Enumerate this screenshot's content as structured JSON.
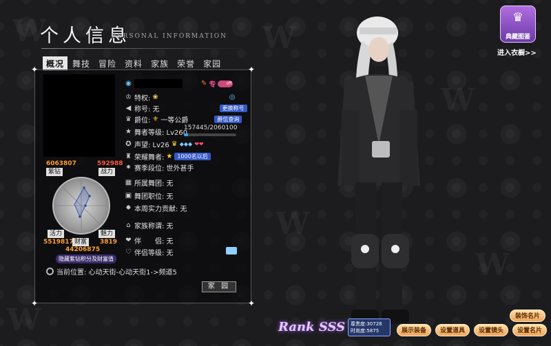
{
  "title": {
    "cn": "个人信息",
    "en": "PERSONAL INFORMATION"
  },
  "tabs": [
    "概况",
    "舞技",
    "冒险",
    "资料",
    "家族",
    "荣誉",
    "家园"
  ],
  "stats": {
    "purple_diamond": {
      "value": "6063807",
      "label": "紫钻"
    },
    "combat": {
      "value": "592988",
      "label": "战力"
    },
    "vitality": {
      "value": "5519817",
      "label": "活力"
    },
    "wealth": {
      "value": "44206875",
      "label": "财富"
    },
    "charm": {
      "value": "3819",
      "label": "魅力"
    }
  },
  "hint": "隐藏紫钻积分及财富值",
  "info": {
    "special_label": "专",
    "toggle": "off",
    "privilege": "特权:",
    "title": "称号: 无",
    "change_title_btn": "更换称号",
    "rank": "爵位:",
    "rank_value": "一等公爵",
    "rank_query_btn": "爵位查询",
    "dancer_level": "舞者等级: Lv260",
    "level_progress": "157445/2060100",
    "level_fraction": 0.0764,
    "reputation": "声望: Lv26",
    "honor_dancer": "荣耀舞者:",
    "honor_btn": "1000名以后",
    "season": "赛季段位: 世外甚手",
    "team": "所属舞团: 无",
    "team_position": "舞团职位: 无",
    "weekly": "本周实力贡献: 无",
    "family_title": "家族称谓: 无",
    "partner": "伴　　侣: 无",
    "partner_level": "伴侣等级: 无"
  },
  "location": "当前位置: 心动天街-心动天街1->频道5",
  "home_btn": "家 园",
  "wardrobe": {
    "label": "典藏图鉴",
    "enter": "进入衣橱>>"
  },
  "rank_badge": "Rank SSS",
  "rank_stats": {
    "contribution": "尊贵度:30728",
    "intimacy": "时尚度:5875"
  },
  "bottom_buttons": [
    "展示装备",
    "设置道具",
    "设置镜头",
    "设置名片"
  ],
  "decorate_btn": "装饰名片"
}
